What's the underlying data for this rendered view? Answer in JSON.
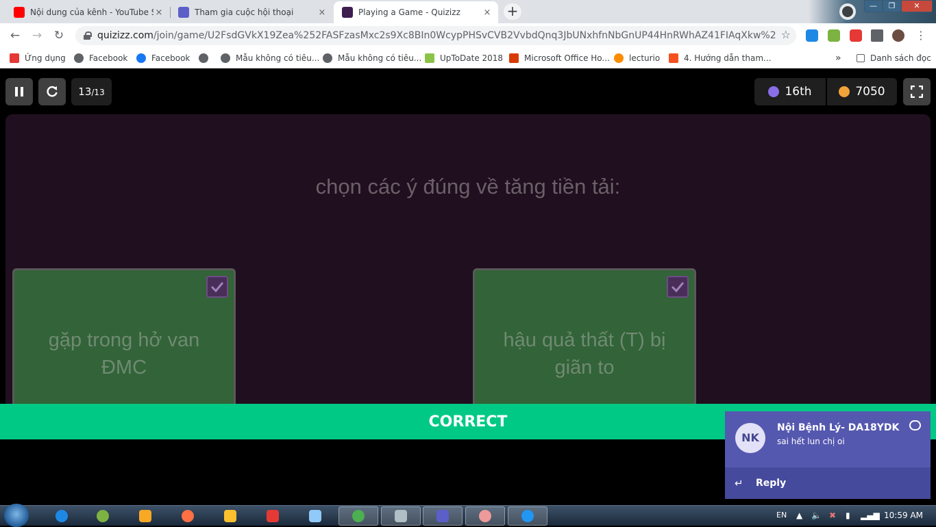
{
  "browser": {
    "tabs": [
      {
        "title": "Nội dung của kênh - YouTube Studio",
        "close": "×"
      },
      {
        "title": "Tham gia cuộc hội thoại",
        "close": "×"
      },
      {
        "title": "Playing a Game - Quizizz",
        "close": "×"
      }
    ],
    "new_tab": "+",
    "window_buttons": {
      "minimize": "—",
      "maximize": "❐",
      "close": "✕"
    },
    "url_host": "quizizz.com",
    "url_path": "/join/game/U2FsdGVkX19Zea%252FASFzasMxc2s9Xc8BIn0WcypPHSvCVB2VvbdQnq3JbUNxhfnNbGnUP44HnRWhAZ41FIAqXkw%253D%253D?ga...",
    "bookmarks": [
      "Ứng dụng",
      "Facebook",
      "Facebook",
      "",
      "Mẫu không có tiêu...",
      "Mẫu không có tiêu...",
      "UpToDate 2018",
      "Microsoft Office Ho...",
      "lecturio",
      "4. Hướng dẫn tham..."
    ],
    "more_bookmarks": "»",
    "reading_list": "Danh sách đọc"
  },
  "game": {
    "counter_current": "13",
    "counter_total": "/13",
    "rank": "16th",
    "score": "7050",
    "question": "chọn các ý đúng về tăng tiền tải:",
    "options": [
      {
        "text": "gặp trong hở van ĐMC",
        "checked": true
      },
      {
        "text": "hậu quả thất (T) bị giãn to",
        "checked": true
      }
    ],
    "result": "CORRECT",
    "colors": {
      "result": "#00c985",
      "option": "#336338",
      "panel": "#1f0f1f"
    }
  },
  "notification": {
    "initials": "NK",
    "sender": "Nội Bệnh Lý- DA18YDK",
    "message": "sai hết lun chị oi",
    "reply_label": "Reply"
  },
  "taskbar": {
    "language": "EN",
    "time": "10:59 AM"
  }
}
